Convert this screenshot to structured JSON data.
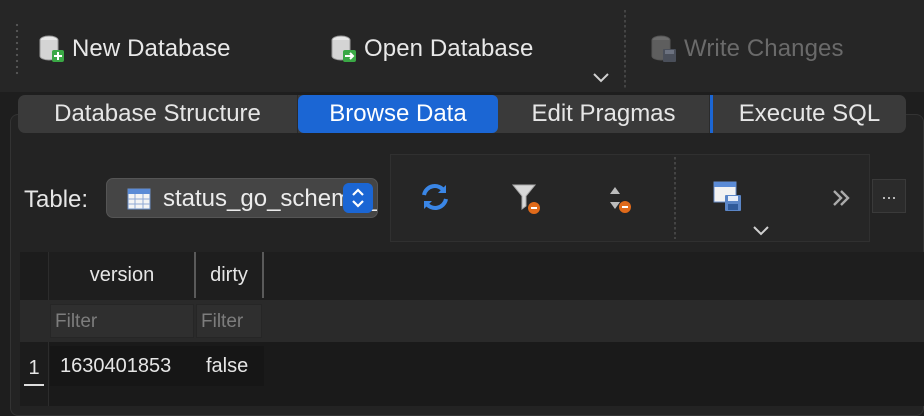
{
  "toolbar": {
    "new_database": "New Database",
    "open_database": "Open Database",
    "write_changes": "Write Changes",
    "icons": [
      "database-new-icon",
      "database-open-icon",
      "database-write-icon",
      "chevron-down-icon"
    ]
  },
  "tabs": [
    {
      "label": "Database Structure",
      "active": false
    },
    {
      "label": "Browse Data",
      "active": true
    },
    {
      "label": "Edit Pragmas",
      "active": false
    },
    {
      "label": "Execute SQL",
      "active": false
    }
  ],
  "browse": {
    "table_label": "Table:",
    "table_value": "status_go_schema_migrations",
    "more_label": "...",
    "tools": [
      "refresh-icon",
      "clear-filters-icon",
      "clear-sort-icon",
      "save-table-icon",
      "overflow-icon"
    ]
  },
  "grid": {
    "columns": [
      "version",
      "dirty"
    ],
    "filter_placeholder": "Filter",
    "rows": [
      {
        "num": "1",
        "cells": [
          "1630401853",
          "false"
        ]
      }
    ]
  },
  "colors": {
    "accent": "#1b66d4",
    "background": "#1e1e1e",
    "text": "#e6e6e6"
  }
}
